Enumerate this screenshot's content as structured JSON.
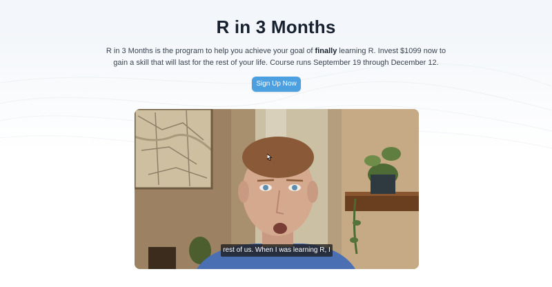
{
  "hero": {
    "title": "R in 3 Months",
    "intro_before": "R in 3 Months is the program to help you achieve your goal of ",
    "intro_bold": "finally",
    "intro_after": " learning R. Invest $1099 now to gain a skill that will last for the rest of your life. Course runs September 19 through December 12.",
    "cta_label": "Sign Up Now"
  },
  "video": {
    "caption": "rest of us. When I was learning R, I"
  },
  "colors": {
    "title": "#16202e",
    "body_text": "#3a4250",
    "cta_background": "#4ca0e0",
    "page_background": "#ffffff"
  },
  "icons": {
    "cursor": "mouse-pointer-icon"
  }
}
